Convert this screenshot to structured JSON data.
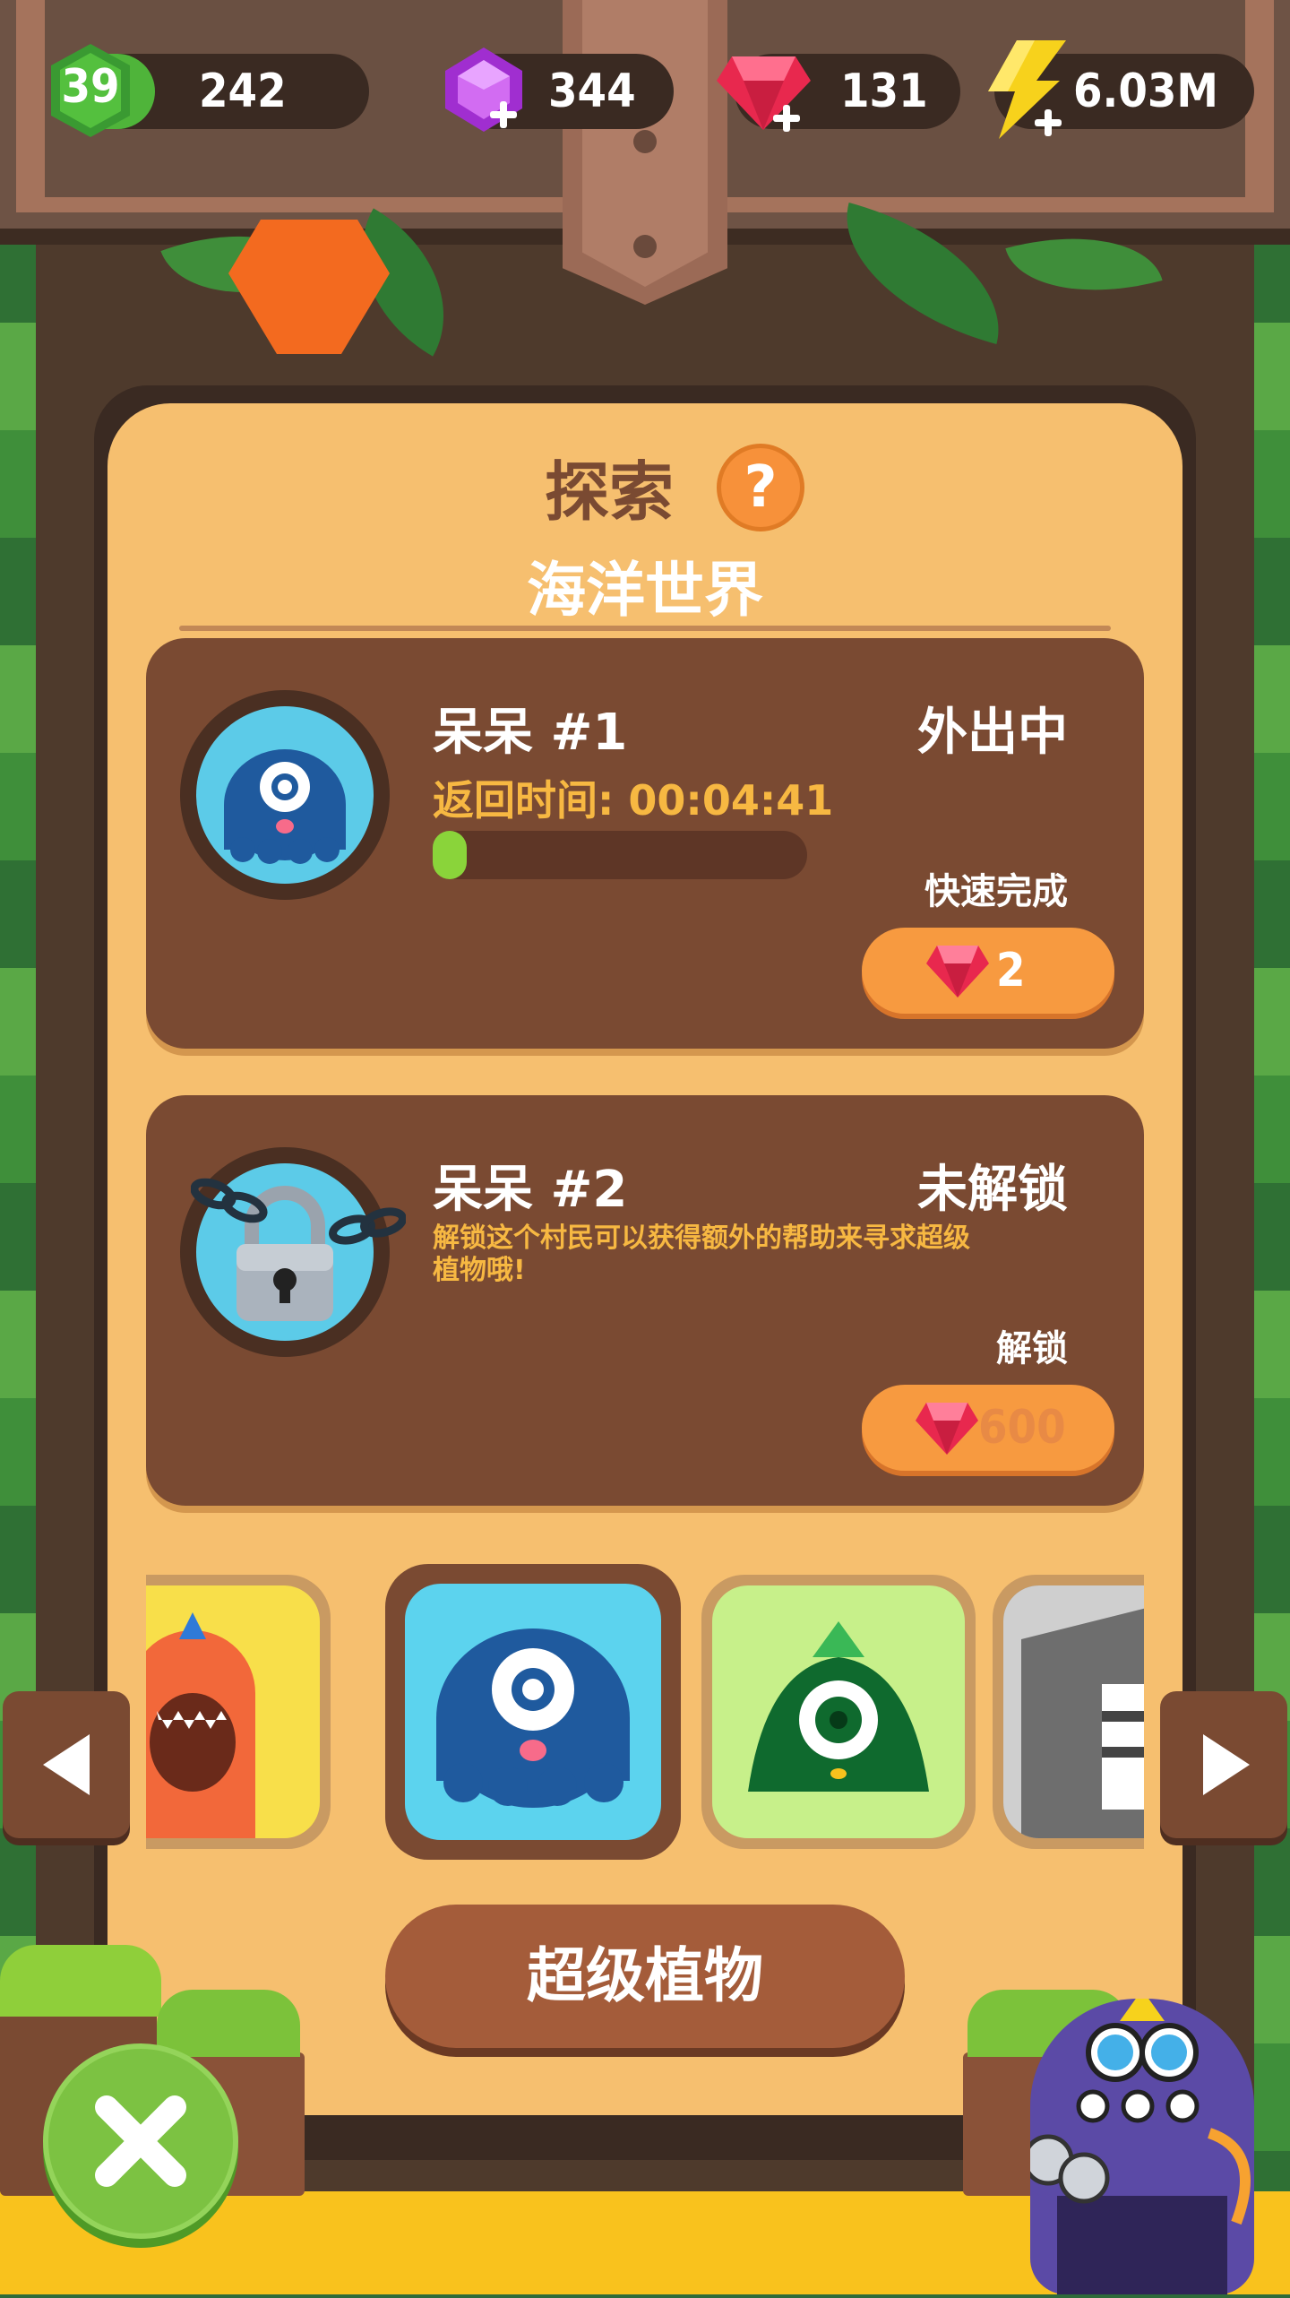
{
  "hud": {
    "level": "39",
    "xp": "242",
    "xp_progress": 0.3,
    "purple_gems": "344",
    "red_gems": "131",
    "energy": "6.03M"
  },
  "panel": {
    "title": "探索",
    "help": "?",
    "subtitle": "海洋世界"
  },
  "slots": [
    {
      "name": "呆呆 #1",
      "status": "外出中",
      "timer": "返回时间: 00:04:41",
      "progress": 0.05,
      "action_label": "快速完成",
      "cost": "2"
    },
    {
      "name": "呆呆 #2",
      "status": "未解锁",
      "description": "解锁这个村民可以获得额外的帮助来寻求超级植物哦!",
      "action_label": "解锁",
      "cost": "600"
    }
  ],
  "carousel": {
    "items": [
      "orange-monster",
      "blue-cyclops",
      "green-cyclops",
      "gray-monster"
    ],
    "selected": 1
  },
  "super_plants_button": "超级植物",
  "colors": {
    "panel": "#f6bf6f",
    "card": "#7a4a32",
    "accent_orange": "#f79a40",
    "gold_text": "#f7b842",
    "progress_green": "#8ad43a"
  }
}
